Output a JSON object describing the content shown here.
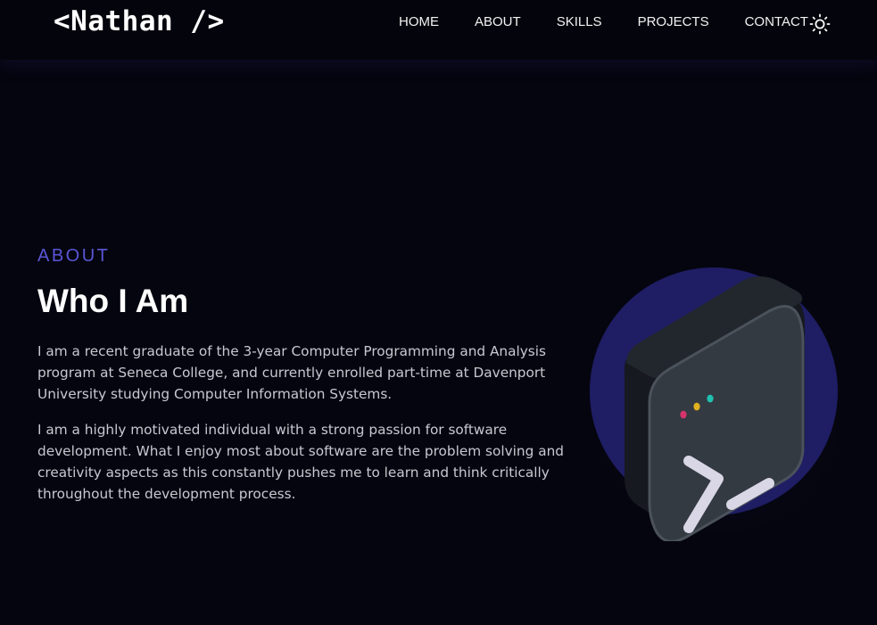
{
  "nav": {
    "logo": "<Nathan />",
    "links": [
      {
        "label": "HOME"
      },
      {
        "label": "ABOUT"
      },
      {
        "label": "SKILLS"
      },
      {
        "label": "PROJECTS"
      },
      {
        "label": "CONTACT"
      }
    ],
    "theme_toggle_icon": "sun-icon"
  },
  "about": {
    "eyebrow": "ABOUT",
    "heading": "Who I Am",
    "paragraph1": "I am a recent graduate of the 3-year Computer Programming and Analysis program at Seneca College, and currently enrolled part-time at Davenport University studying Computer Information Systems.",
    "paragraph2": "I am a highly motivated individual with a strong passion for software development. What I enjoy most about software are the problem solving and creativity aspects as this constantly pushes me to learn and think critically throughout the development process.",
    "illustration_icon": "terminal-icon"
  },
  "colors": {
    "background": "#05050f",
    "navbar": "#04040c",
    "accent": "#5a56d6",
    "circle": "#1f1d64",
    "dot_pink": "#d6336c",
    "dot_yellow": "#e0b020",
    "dot_teal": "#20c0b0"
  }
}
